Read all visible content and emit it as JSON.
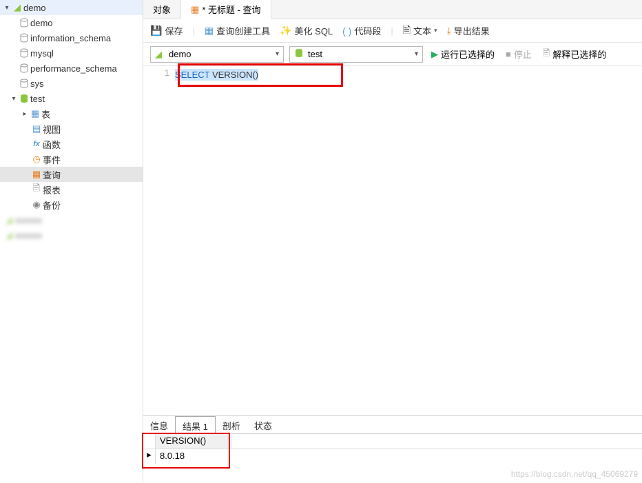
{
  "sidebar": {
    "items": [
      {
        "label": "demo",
        "type": "conn",
        "expanded": true,
        "depth": 0
      },
      {
        "label": "demo",
        "type": "db",
        "depth": 1
      },
      {
        "label": "information_schema",
        "type": "db",
        "depth": 1
      },
      {
        "label": "mysql",
        "type": "db",
        "depth": 1
      },
      {
        "label": "performance_schema",
        "type": "db",
        "depth": 1
      },
      {
        "label": "sys",
        "type": "db",
        "depth": 1
      },
      {
        "label": "test",
        "type": "db-active",
        "expanded": true,
        "depth": 1
      },
      {
        "label": "表",
        "type": "table",
        "hasChildren": true,
        "depth": 2
      },
      {
        "label": "视图",
        "type": "view",
        "depth": 2
      },
      {
        "label": "函数",
        "type": "fx",
        "depth": 2
      },
      {
        "label": "事件",
        "type": "event",
        "depth": 2
      },
      {
        "label": "查询",
        "type": "query",
        "selected": true,
        "depth": 2
      },
      {
        "label": "报表",
        "type": "report",
        "depth": 2
      },
      {
        "label": "备份",
        "type": "backup",
        "depth": 2
      }
    ]
  },
  "tabs": {
    "first": "对象",
    "second": "* 无标题 - 查询"
  },
  "toolbar": {
    "save": "保存",
    "builder": "查询创建工具",
    "beautify": "美化 SQL",
    "snippet": "代码段",
    "text": "文本",
    "export": "导出结果"
  },
  "selectors": {
    "conn": "demo",
    "db": "test"
  },
  "actions": {
    "run": "运行已选择的",
    "stop": "停止",
    "explain": "解释已选择的"
  },
  "editor": {
    "line_no": "1",
    "keyword": "SELECT",
    "func": "VERSION()"
  },
  "bottom_tabs": {
    "info": "信息",
    "result": "结果 1",
    "profile": "剖析",
    "status": "状态"
  },
  "result": {
    "header": "VERSION()",
    "value": "8.0.18"
  },
  "watermark": "https://blog.csdn.net/qq_45069279"
}
